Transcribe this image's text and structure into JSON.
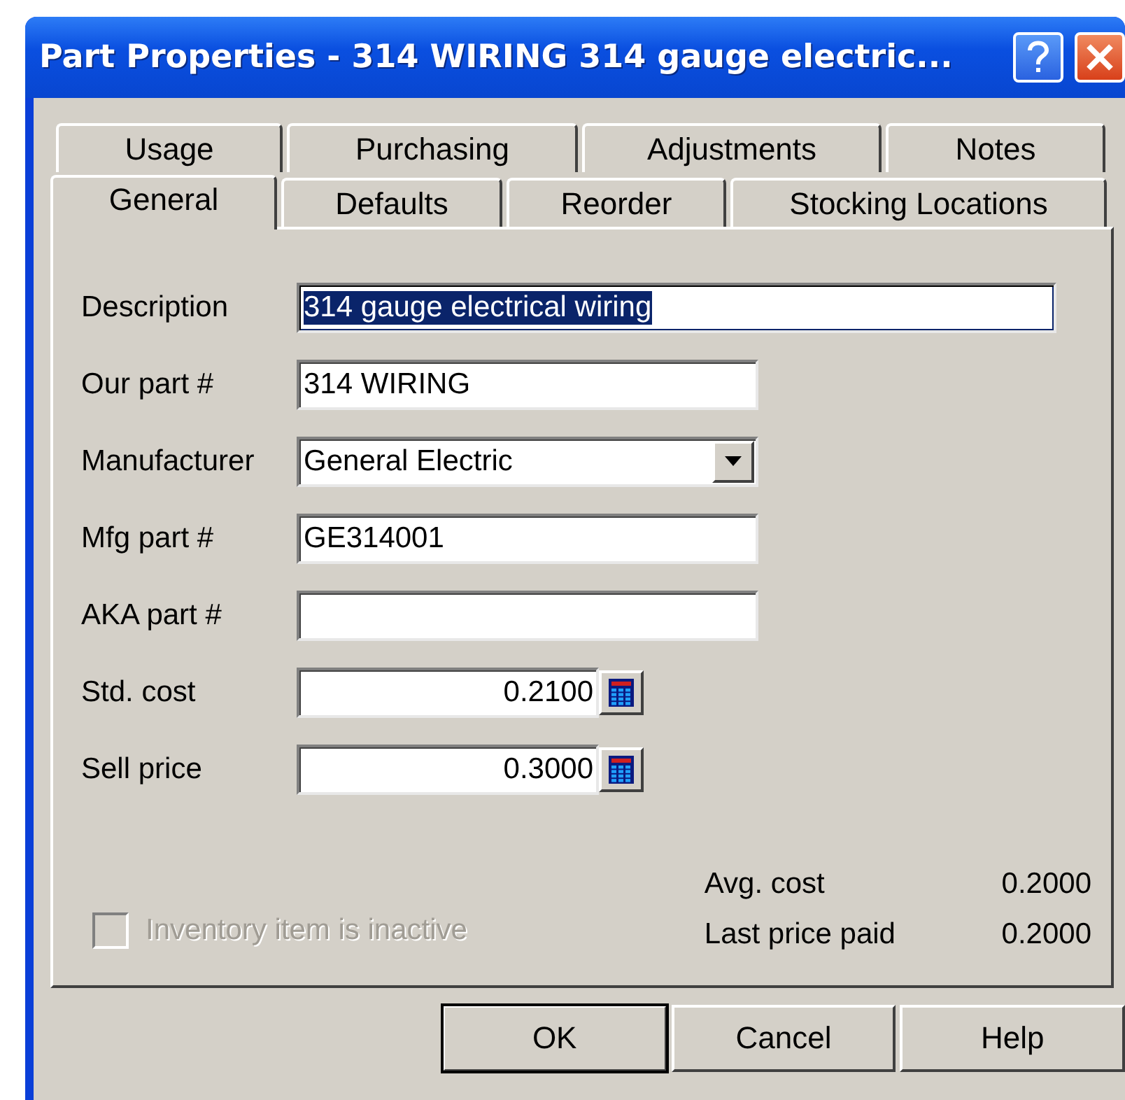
{
  "window": {
    "title": "Part Properties - 314 WIRING 314 gauge electric..."
  },
  "tab_rows": [
    [
      {
        "label": "Usage",
        "selected": false
      },
      {
        "label": "Purchasing",
        "selected": false
      },
      {
        "label": "Adjustments",
        "selected": false
      },
      {
        "label": "Notes",
        "selected": false
      }
    ],
    [
      {
        "label": "General",
        "selected": true
      },
      {
        "label": "Defaults",
        "selected": false
      },
      {
        "label": "Reorder",
        "selected": false
      },
      {
        "label": "Stocking Locations",
        "selected": false
      }
    ]
  ],
  "fields": [
    {
      "label": "Description",
      "kind": "wide",
      "value": "314 gauge electrical wiring",
      "highlighted": true
    },
    {
      "label": "Our part #",
      "kind": "text",
      "value": "314 WIRING",
      "highlighted": false
    },
    {
      "label": "Manufacturer",
      "kind": "dropdown",
      "value": "General Electric",
      "highlighted": false
    },
    {
      "label": "Mfg part #",
      "kind": "text",
      "value": "GE314001",
      "highlighted": false
    },
    {
      "label": "AKA part #",
      "kind": "text",
      "highlighted": false
    },
    {
      "label": "Std. cost",
      "kind": "calc",
      "value": "0.2100",
      "highlighted": false
    },
    {
      "label": "Sell price",
      "kind": "calc",
      "value": "0.3000",
      "highlighted": false
    }
  ],
  "inactive_checkbox": {
    "label": "Inventory item is inactive",
    "checked": false,
    "disabled": true
  },
  "stats": [
    {
      "label": "Avg. cost",
      "value": "0.2000"
    },
    {
      "label": "Last price paid",
      "value": "0.2000"
    }
  ],
  "buttons": [
    {
      "label": "OK",
      "default": true
    },
    {
      "label": "Cancel",
      "default": false
    },
    {
      "label": "Help",
      "default": false
    }
  ]
}
